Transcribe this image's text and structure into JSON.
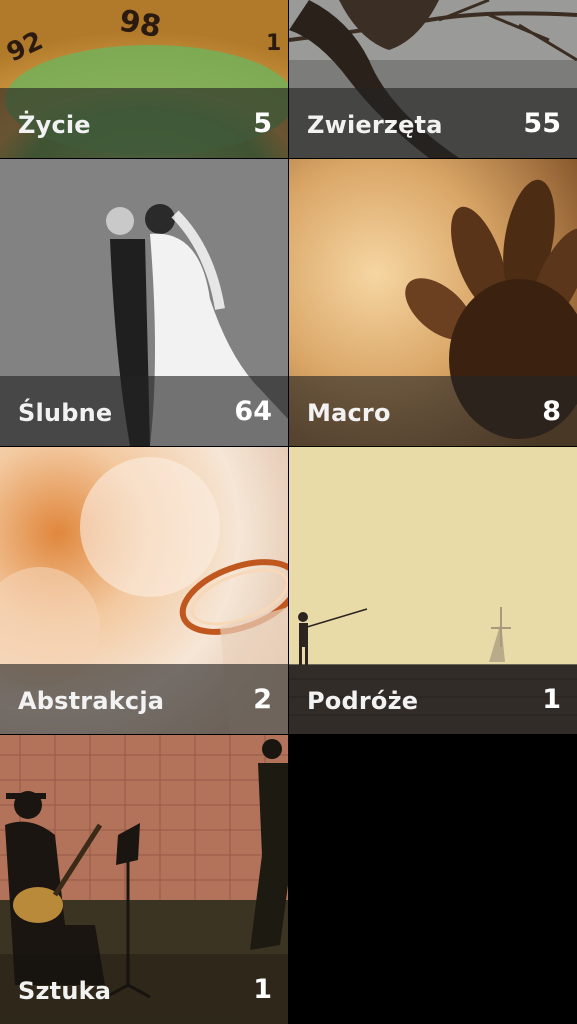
{
  "albums": [
    {
      "id": "zycie",
      "label": "Życie",
      "count": "5",
      "photo_icon": "clock-dial-photo"
    },
    {
      "id": "zwierzeta",
      "label": "Zwierzęta",
      "count": "55",
      "photo_icon": "bird-on-branch-photo"
    },
    {
      "id": "slubne",
      "label": "Ślubne",
      "count": "64",
      "photo_icon": "wedding-couple-photo"
    },
    {
      "id": "macro",
      "label": "Macro",
      "count": "8",
      "photo_icon": "flower-macro-photo"
    },
    {
      "id": "abstrakcja",
      "label": "Abstrakcja",
      "count": "2",
      "photo_icon": "glass-bokeh-photo"
    },
    {
      "id": "podroze",
      "label": "Podróże",
      "count": "1",
      "photo_icon": "fisherman-pier-photo"
    },
    {
      "id": "sztuka",
      "label": "Sztuka",
      "count": "1",
      "photo_icon": "street-musician-photo"
    }
  ],
  "colors": {
    "background": "#000000",
    "label_bar": "#232323",
    "label_text": "#f2f2f2"
  }
}
